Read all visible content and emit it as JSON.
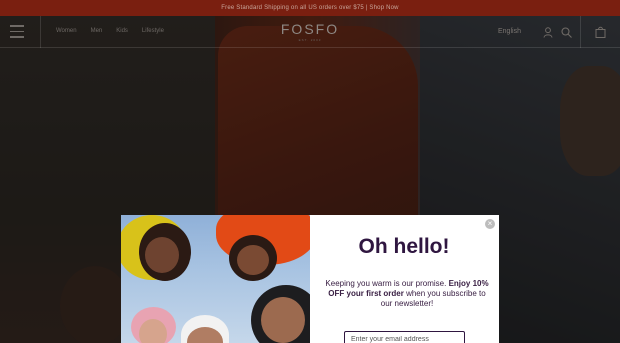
{
  "announcement": {
    "text": "Free Standard Shipping on all US orders over $75 | Shop Now"
  },
  "header": {
    "nav": [
      "Women",
      "Men",
      "Kids",
      "Lifestyle"
    ],
    "logo": "FOSFO",
    "logo_sub": "EST. 2003",
    "language": "English",
    "icons": [
      "menu-icon",
      "user-icon",
      "search-icon",
      "cart-icon"
    ]
  },
  "modal": {
    "title": "Oh hello!",
    "promo_pre": "Keeping you warm is our promise. ",
    "promo_bold": "Enjoy 10% OFF your first order",
    "promo_post": " when you subscribe to our newsletter!",
    "email_placeholder": "Enter your email address",
    "close_symbol": "×"
  },
  "colors": {
    "announcement_bg": "#7a1f10",
    "modal_text": "#2f1640",
    "hero_jacket": "#6e2a16"
  }
}
